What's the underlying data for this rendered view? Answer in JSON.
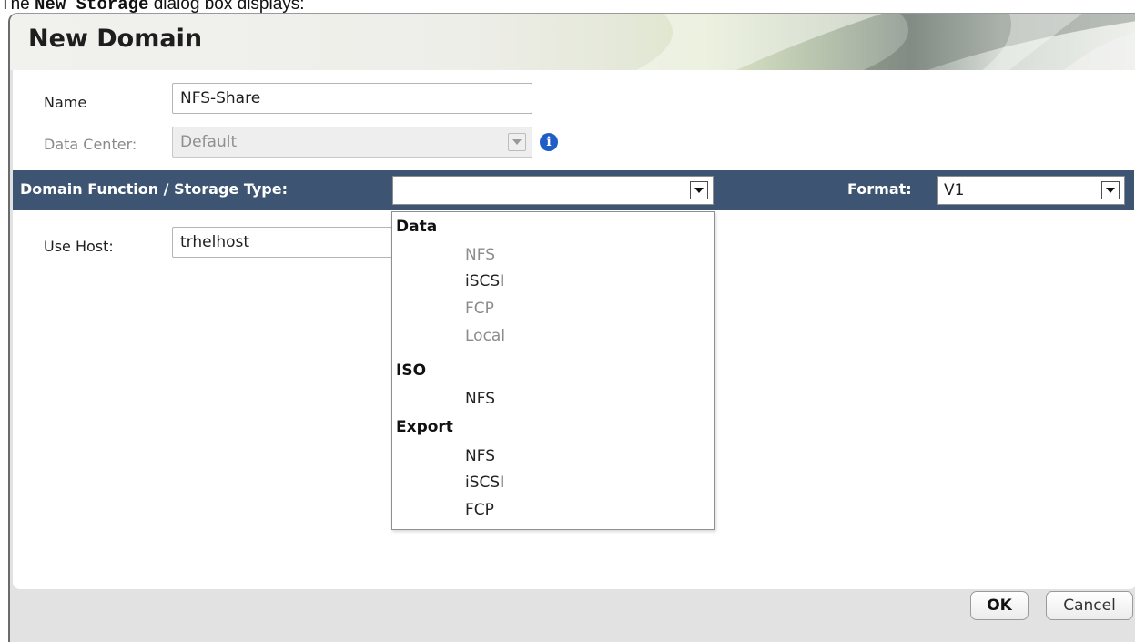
{
  "caption": {
    "prefix": "The ",
    "code": "New Storage",
    "suffix": " dialog box displays:"
  },
  "dialog": {
    "title": "New Domain",
    "name_label": "Name",
    "name_value": "NFS-Share",
    "data_center_label": "Data Center:",
    "data_center_value": "Default",
    "function_label": "Domain Function / Storage Type:",
    "function_value": "",
    "format_label": "Format:",
    "format_value": "V1",
    "use_host_label": "Use Host:",
    "use_host_value": "trhelhost"
  },
  "dropdown": {
    "groups": [
      {
        "label": "Data",
        "options": [
          {
            "label": "NFS",
            "disabled": true
          },
          {
            "label": "iSCSI",
            "disabled": false
          },
          {
            "label": "FCP",
            "disabled": true
          },
          {
            "label": "Local",
            "disabled": true
          }
        ]
      },
      {
        "label": "ISO",
        "options": [
          {
            "label": "NFS",
            "disabled": false
          }
        ]
      },
      {
        "label": "Export",
        "options": [
          {
            "label": "NFS",
            "disabled": false
          },
          {
            "label": "iSCSI",
            "disabled": false
          },
          {
            "label": "FCP",
            "disabled": false
          }
        ]
      }
    ]
  },
  "buttons": {
    "ok": "OK",
    "cancel": "Cancel"
  },
  "icons": {
    "info": "info-icon",
    "dropdown": "chevron-down-icon"
  }
}
